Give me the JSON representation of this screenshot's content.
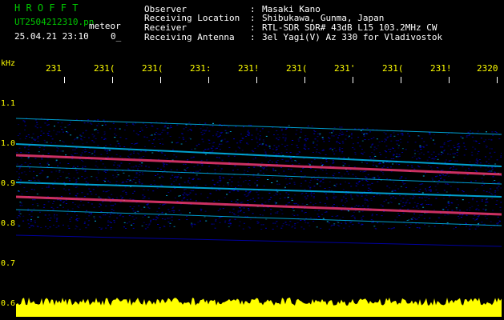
{
  "header": {
    "brand": "H R O F F T",
    "filename": "UT2504212310.pn",
    "tag": "meteor",
    "datetime": "25.04.21 23:10",
    "status_code": "0_"
  },
  "info": [
    {
      "label": "Observer",
      "sep": ":",
      "value": "Masaki Kano"
    },
    {
      "label": "Receiving Location",
      "sep": ":",
      "value": "Shibukawa, Gunma, Japan"
    },
    {
      "label": "Receiver",
      "sep": ":",
      "value": "RTL-SDR SDR# 43dB L15 103.2MHz CW"
    },
    {
      "label": "Receiving Antenna",
      "sep": ":",
      "value": "3el Yagi(V) Az 330 for Vladivostok"
    }
  ],
  "axis": {
    "y_unit": "kHz",
    "x_labels": [
      "231",
      "231(",
      "231(",
      "231:",
      "231!",
      "231(",
      "231'",
      "231(",
      "231!",
      "2320"
    ],
    "y_labels": [
      "1.1",
      "1.0",
      "0.9",
      "0.8",
      "0.7",
      "0.6"
    ]
  },
  "colors": {
    "background": "#000000",
    "title_text": "#00c800",
    "axis_text": "#ffff00",
    "info_text": "#ffffff",
    "spectrum_low": "#0000c8",
    "spectrum_mid": "#00c8ff",
    "spectrum_high": "#ff3c78",
    "amplitude": "#ffff00"
  }
}
